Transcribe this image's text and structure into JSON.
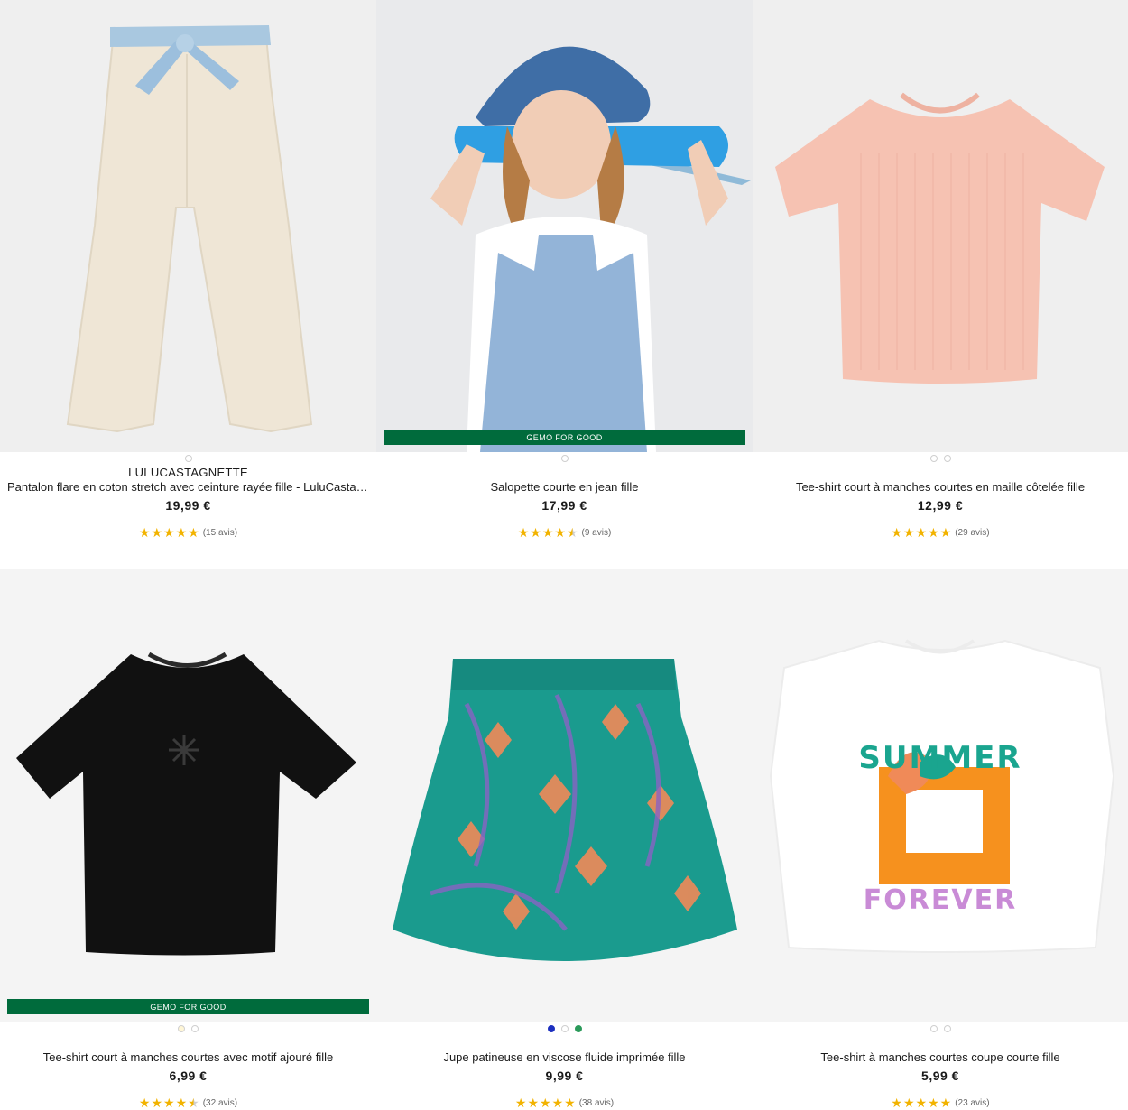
{
  "products": [
    {
      "brand": "LULUCASTAGNETTE",
      "title": "Pantalon flare en coton stretch avec ceinture rayée fille - LuluCastagnette",
      "price": "19,99 €",
      "rating": 5,
      "reviews": "(15 avis)",
      "badge": "",
      "swatches": [
        "#ffffff"
      ],
      "image_icon": "flared-pants-image"
    },
    {
      "brand": "",
      "title": "Salopette courte en jean fille",
      "price": "17,99 €",
      "rating": 4.5,
      "reviews": "(9 avis)",
      "badge": "GEMO FOR GOOD",
      "swatches": [
        "#ffffff"
      ],
      "image_icon": "denim-overall-model-image"
    },
    {
      "brand": "",
      "title": "Tee-shirt court à manches courtes en maille côtelée fille",
      "price": "12,99 €",
      "rating": 5,
      "reviews": "(29 avis)",
      "badge": "",
      "swatches": [
        "#ffffff",
        "#ffffff"
      ],
      "image_icon": "pink-ribbed-tee-image"
    },
    {
      "brand": "",
      "title": "Tee-shirt court à manches courtes avec motif ajouré fille",
      "price": "6,99 €",
      "rating": 4.5,
      "reviews": "(32 avis)",
      "badge": "GEMO FOR GOOD",
      "swatches": [
        "#fff6d6",
        "#ffffff"
      ],
      "image_icon": "black-tee-image"
    },
    {
      "brand": "",
      "title": "Jupe patineuse en viscose fluide imprimée fille",
      "price": "9,99 €",
      "rating": 5,
      "reviews": "(38 avis)",
      "badge": "",
      "swatches": [
        "#1c2fbf",
        "#ffffff",
        "#2b9a5a"
      ],
      "image_icon": "printed-skater-skirt-image"
    },
    {
      "brand": "",
      "title": "Tee-shirt à manches courtes coupe courte fille",
      "price": "5,99 €",
      "rating": 5,
      "reviews": "(23 avis)",
      "badge": "",
      "swatches": [
        "#ffffff",
        "#ffffff"
      ],
      "image_icon": "summer-forever-tee-image"
    }
  ]
}
